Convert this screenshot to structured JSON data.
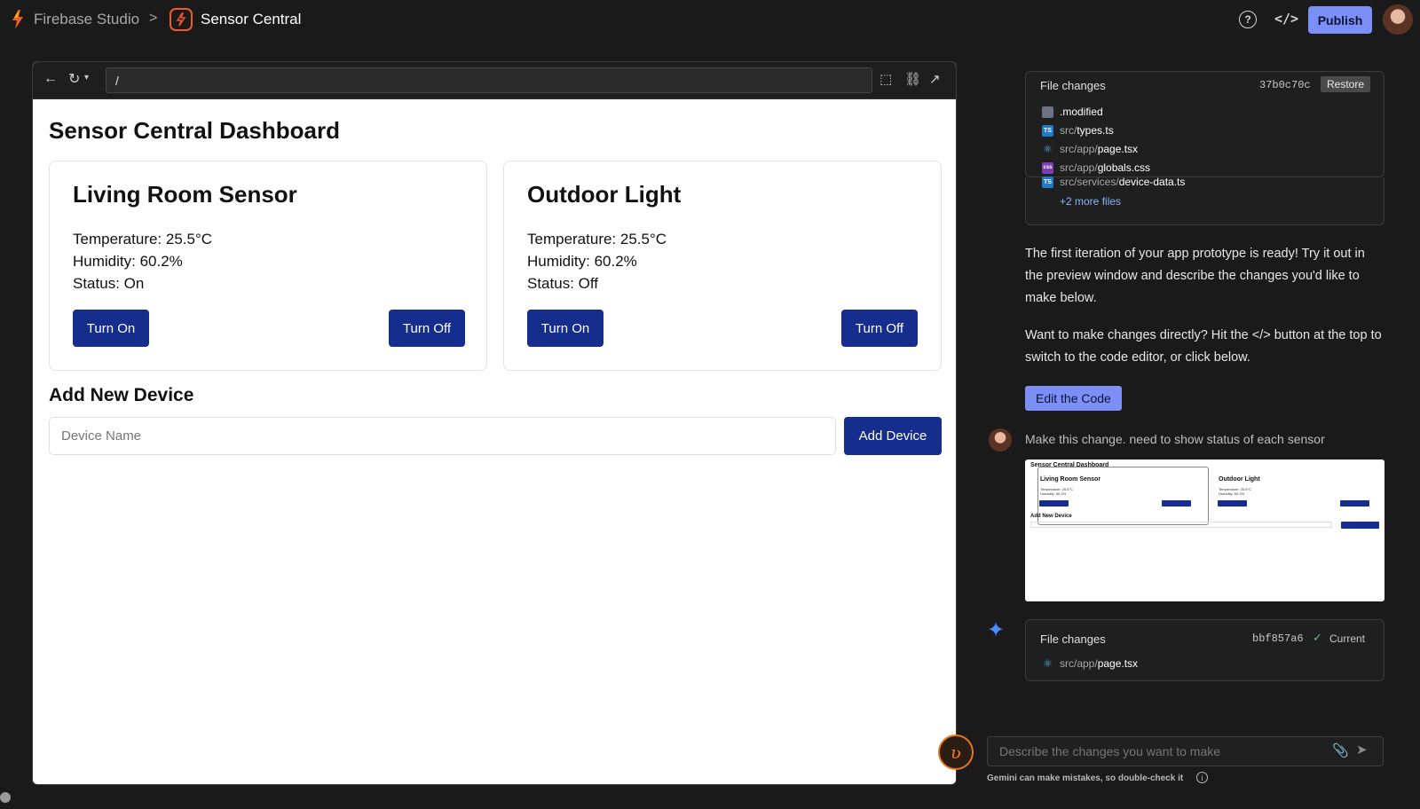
{
  "topbar": {
    "brand": "Firebase Studio",
    "separator": ">",
    "project": "Sensor Central",
    "publish_label": "Publish",
    "help_glyph": "?",
    "code_glyph": "</>"
  },
  "preview": {
    "url_value": "/",
    "title": "Sensor Central Dashboard",
    "cards": [
      {
        "name": "Living Room Sensor",
        "temperature": "Temperature: 25.5°C",
        "humidity": "Humidity: 60.2%",
        "status": "Status: On",
        "on_label": "Turn On",
        "off_label": "Turn Off"
      },
      {
        "name": "Outdoor Light",
        "temperature": "Temperature: 25.5°C",
        "humidity": "Humidity: 60.2%",
        "status": "Status: Off",
        "on_label": "Turn On",
        "off_label": "Turn Off"
      }
    ],
    "add_title": "Add New Device",
    "device_placeholder": "Device Name",
    "add_button": "Add Device"
  },
  "chat": {
    "file_changes_1": {
      "label": "File changes",
      "hash": "37b0c70c",
      "restore": "Restore",
      "files": [
        {
          "dir": "",
          "name": ".modified",
          "icon": "file-icon",
          "badge": ""
        },
        {
          "dir": "src/",
          "name": "types.ts",
          "icon": "typescript-icon",
          "badge": "TS"
        },
        {
          "dir": "src/app/",
          "name": "page.tsx",
          "icon": "react-icon",
          "badge": "⚛"
        },
        {
          "dir": "src/app/",
          "name": "globals.css",
          "icon": "css-icon",
          "badge": "css"
        },
        {
          "dir": "src/services/",
          "name": "device-data.ts",
          "icon": "typescript-icon",
          "badge": "TS"
        }
      ],
      "more": "+2 more files"
    },
    "message_1": "The first iteration of your app prototype is ready! Try it out in the preview window and describe the changes you'd like to make below.",
    "message_2": "Want to make changes directly? Hit the </> button at the top to switch to the code editor, or click below.",
    "edit_code": "Edit the Code",
    "user_message": "Make this change. need to show status of each sensor",
    "thumbnail": {
      "title": "Sensor Central Dashboard",
      "card1": "Living Room Sensor",
      "card2": "Outdoor Light",
      "line1": "Temperature: 25.5°C",
      "line2": "Humidity: 60.2%",
      "add": "Add New Device",
      "input": "Device Name"
    },
    "file_changes_2": {
      "label": "File changes",
      "hash": "bbf857a6",
      "current": "Current",
      "files": [
        {
          "dir": "src/app/",
          "name": "page.tsx",
          "icon": "react-icon",
          "badge": "⚛"
        }
      ]
    },
    "input_placeholder": "Describe the changes you want to make",
    "disclaimer": "Gemini can make mistakes, so double-check it"
  },
  "colors": {
    "background": "#1a1a1a",
    "accent": "#7b8ff7",
    "navy_button": "#152d8c",
    "firebase_orange": "#f05a28"
  }
}
